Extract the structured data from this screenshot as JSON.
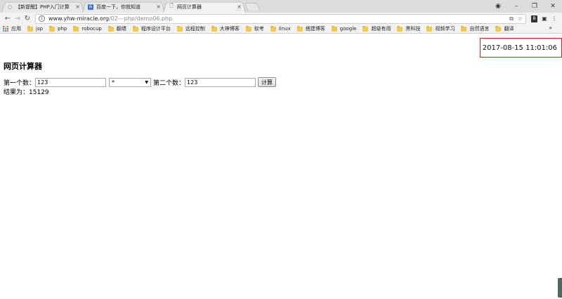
{
  "tabs": [
    {
      "title": "【新提醒】PHP入门计算",
      "icon": "loading-icon",
      "active": false
    },
    {
      "title": "百度一下，你就知道",
      "icon": "baidu-icon",
      "active": false
    },
    {
      "title": "网页计算器",
      "icon": "document-icon",
      "active": true
    }
  ],
  "tab_close_glyph": "×",
  "window_controls": {
    "profile": "◉",
    "minimize": "–",
    "restore": "❐",
    "close": "✕"
  },
  "address": {
    "host": "www.yhw-miracle.org",
    "path": "/02---php/demo06.php"
  },
  "toolbar": {
    "translate": "⧉",
    "star": "☆",
    "ext_label": "B",
    "menu": "⋮"
  },
  "bookmarks": {
    "apps_label": "应用",
    "items": [
      "jsp",
      "php",
      "robocup",
      "翻墙",
      "程序设计平台",
      "远程控制",
      "大神博客",
      "软考",
      "linux",
      "搭建博客",
      "google",
      "超级有用",
      "黑科技",
      "视频学习",
      "自然语言",
      "翻译"
    ],
    "more": "»"
  },
  "page": {
    "datetime": "2017-08-15 11:01:06",
    "title": "网页计算器",
    "first_label": "第一个数：",
    "first_value": "123",
    "operator": "*",
    "second_label": "第二个数：",
    "second_value": "123",
    "calc_button": "计算",
    "result_text": "结果为：15129"
  },
  "colors": {
    "highlight_border": "#d4231f",
    "folder": "#f2c94c"
  }
}
